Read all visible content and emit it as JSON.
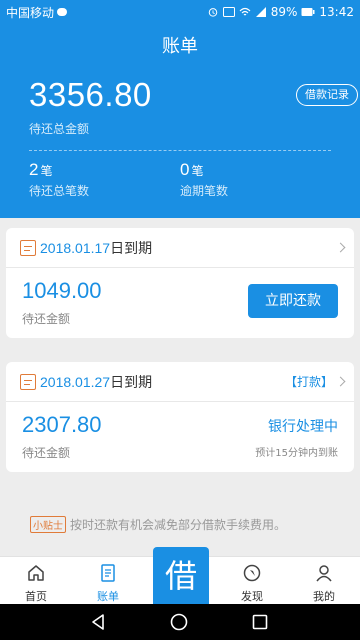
{
  "status_bar": {
    "carrier": "中国移动",
    "battery": "89%",
    "time": "13:42"
  },
  "header": {
    "title": "账单",
    "total_amount": "3356.80",
    "total_label": "待还总金额",
    "record_button": "借款记录",
    "count_num": "2",
    "count_unit": "笔",
    "count_label": "待还总笔数",
    "overdue_num": "0",
    "overdue_unit": "笔",
    "overdue_label": "逾期笔数"
  },
  "bills": [
    {
      "date": "2018.01.17",
      "date_suffix": "日到期",
      "tag": "",
      "amount": "1049.00",
      "amount_label": "待还金额",
      "action": "立即还款"
    },
    {
      "date": "2018.01.27",
      "date_suffix": "日到期",
      "tag": "【打款】",
      "amount": "2307.80",
      "amount_label": "待还金额",
      "status": "银行处理中",
      "note": "预计15分钟内到账"
    }
  ],
  "tip": {
    "badge": "小贴士",
    "text": "按时还款有机会减免部分借款手续费用。"
  },
  "tabbar": {
    "home": "首页",
    "bill": "账单",
    "borrow": "借",
    "discover": "发现",
    "mine": "我的"
  },
  "colors": {
    "primary": "#1a8fe3",
    "accent_orange": "#e07b39"
  }
}
